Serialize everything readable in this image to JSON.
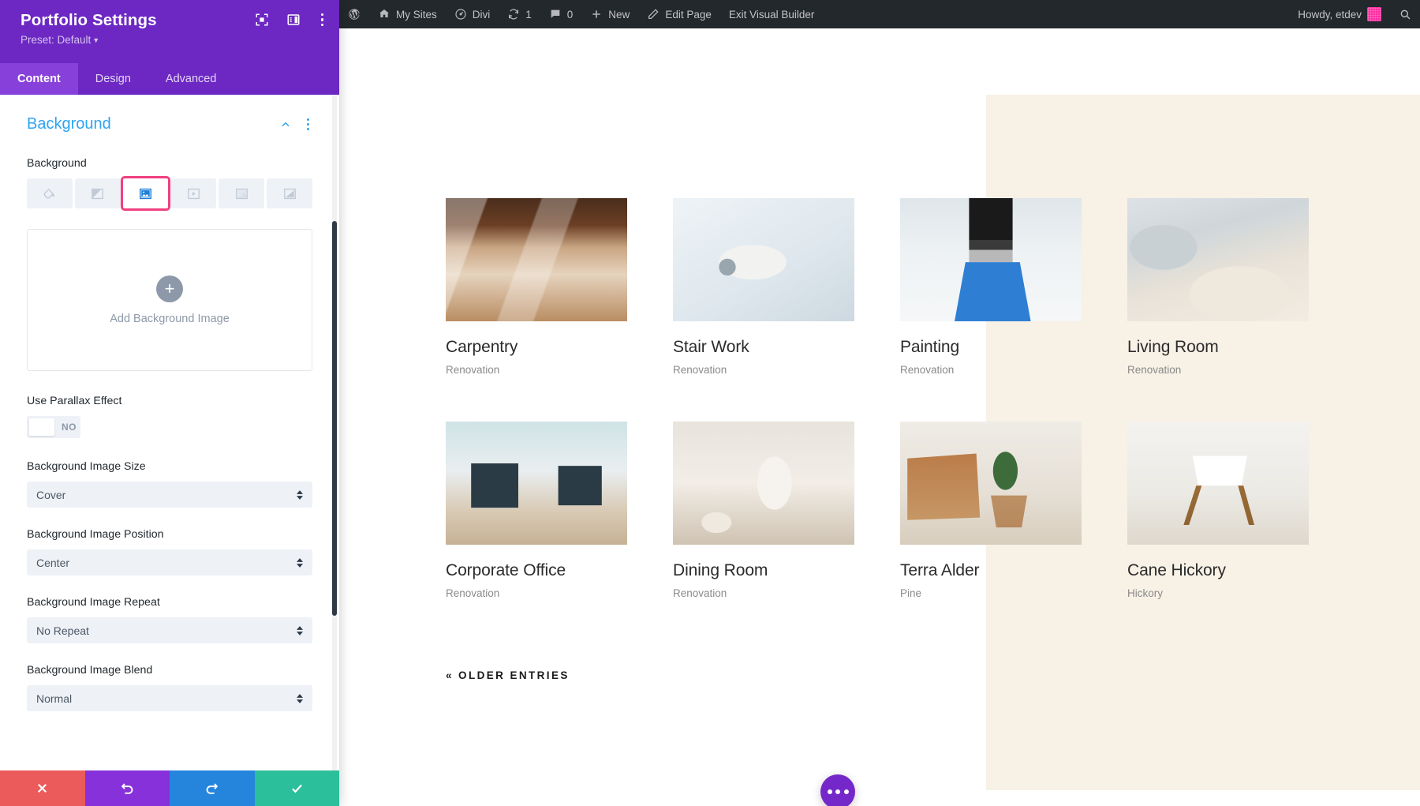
{
  "settings_panel": {
    "title": "Portfolio Settings",
    "preset": "Preset: Default",
    "head_icons": [
      "fullscreen-icon",
      "panel-layout-icon",
      "more-vertical-icon"
    ],
    "tabs": [
      {
        "label": "Content",
        "active": true
      },
      {
        "label": "Design",
        "active": false
      },
      {
        "label": "Advanced",
        "active": false
      }
    ],
    "section": {
      "title": "Background",
      "collapse_icon": "chevron-up-icon",
      "menu_icon": "more-vertical-icon"
    },
    "background": {
      "label": "Background",
      "types": [
        {
          "name": "background-color",
          "icon": "paint-bucket-icon",
          "selected": false
        },
        {
          "name": "background-gradient",
          "icon": "gradient-icon",
          "selected": false
        },
        {
          "name": "background-image",
          "icon": "image-icon",
          "selected": true
        },
        {
          "name": "background-video",
          "icon": "video-icon",
          "selected": false
        },
        {
          "name": "background-pattern",
          "icon": "pattern-icon",
          "selected": false
        },
        {
          "name": "background-mask",
          "icon": "mask-icon",
          "selected": false
        }
      ],
      "selected_highlight_color": "#f0407f",
      "upload": {
        "plus": "+",
        "label": "Add Background Image"
      }
    },
    "parallax": {
      "label": "Use Parallax Effect",
      "value": "NO"
    },
    "fields": [
      {
        "label": "Background Image Size",
        "value": "Cover",
        "name": "background-image-size"
      },
      {
        "label": "Background Image Position",
        "value": "Center",
        "name": "background-image-position"
      },
      {
        "label": "Background Image Repeat",
        "value": "No Repeat",
        "name": "background-image-repeat"
      },
      {
        "label": "Background Image Blend",
        "value": "Normal",
        "name": "background-image-blend"
      }
    ],
    "actions": [
      {
        "name": "cancel-button",
        "icon": "close-icon",
        "color": "#eb5b5b"
      },
      {
        "name": "undo-button",
        "icon": "undo-icon",
        "color": "#8731da"
      },
      {
        "name": "redo-button",
        "icon": "redo-icon",
        "color": "#2585dd"
      },
      {
        "name": "save-button",
        "icon": "check-icon",
        "color": "#2bbf9b"
      }
    ]
  },
  "adminbar": {
    "left_items": [
      {
        "label": "",
        "icon": "wordpress-logo-icon",
        "name": "wp-logo"
      },
      {
        "label": "My Sites",
        "icon": "sites-icon",
        "name": "my-sites"
      },
      {
        "label": "Divi",
        "icon": "divi-icon",
        "name": "divi"
      },
      {
        "label": "1",
        "icon": "updates-icon",
        "name": "updates"
      },
      {
        "label": "0",
        "icon": "comment-icon",
        "name": "comments"
      },
      {
        "label": "New",
        "icon": "plus-icon",
        "name": "new-content"
      },
      {
        "label": "Edit Page",
        "icon": "pencil-icon",
        "name": "edit-page"
      },
      {
        "label": "Exit Visual Builder",
        "icon": "",
        "name": "exit-visual-builder"
      }
    ],
    "right": {
      "howdy": "Howdy, etdev",
      "avatar_color": "#ff2ea0",
      "search_icon": "search-icon"
    }
  },
  "canvas": {
    "portfolio": [
      {
        "title": "Carpentry",
        "category": "Renovation",
        "art": "wood"
      },
      {
        "title": "Stair Work",
        "category": "Renovation",
        "art": "roller"
      },
      {
        "title": "Painting",
        "category": "Renovation",
        "art": "brush"
      },
      {
        "title": "Living Room",
        "category": "Renovation",
        "art": "sofa"
      },
      {
        "title": "Corporate Office",
        "category": "Renovation",
        "art": "desk"
      },
      {
        "title": "Dining Room",
        "category": "Renovation",
        "art": "table"
      },
      {
        "title": "Terra Alder",
        "category": "Pine",
        "art": "plant"
      },
      {
        "title": "Cane Hickory",
        "category": "Hickory",
        "art": "chair"
      }
    ],
    "pagination": {
      "label": "« OLDER ENTRIES"
    },
    "fab": {
      "name": "divi-menu-fab",
      "color": "#7528c9",
      "icon": "more-horizontal-icon"
    }
  }
}
